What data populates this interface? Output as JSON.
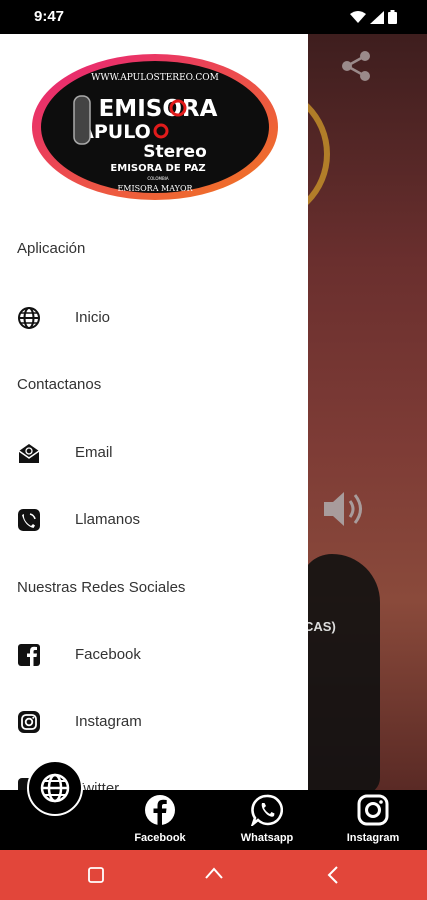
{
  "status_bar": {
    "time": "9:47"
  },
  "logo": {
    "url": "WWW.APULOSTEREO.COM",
    "line1": "EMISORA",
    "line2": "APULO",
    "line3": "Stereo",
    "line4": "EMISORA DE PAZ",
    "line5": "COLOMBIA",
    "line6": "EMISORA MAYOR"
  },
  "drawer": {
    "sections": [
      {
        "header": "Aplicación",
        "items": [
          {
            "label": "Inicio",
            "icon": "globe-icon"
          }
        ]
      },
      {
        "header": "Contactanos",
        "items": [
          {
            "label": "Email",
            "icon": "email-icon"
          },
          {
            "label": "Llamanos",
            "icon": "phone-icon"
          }
        ]
      },
      {
        "header": "Nuestras Redes Sociales",
        "items": [
          {
            "label": "Facebook",
            "icon": "facebook-icon"
          },
          {
            "label": "Instagram",
            "icon": "instagram-icon"
          },
          {
            "label": "Twitter",
            "icon": "twitter-icon"
          }
        ]
      }
    ]
  },
  "background": {
    "partial_text": "CAS)"
  },
  "bottom_nav": {
    "items": [
      {
        "label": "Facebook",
        "icon": "facebook-icon"
      },
      {
        "label": "Whatsapp",
        "icon": "whatsapp-icon"
      },
      {
        "label": "Instagram",
        "icon": "instagram-icon"
      }
    ]
  },
  "colors": {
    "system_nav": "#e2463a",
    "logo_ring": "#e8207a",
    "logo_accent": "#e11b1b"
  }
}
